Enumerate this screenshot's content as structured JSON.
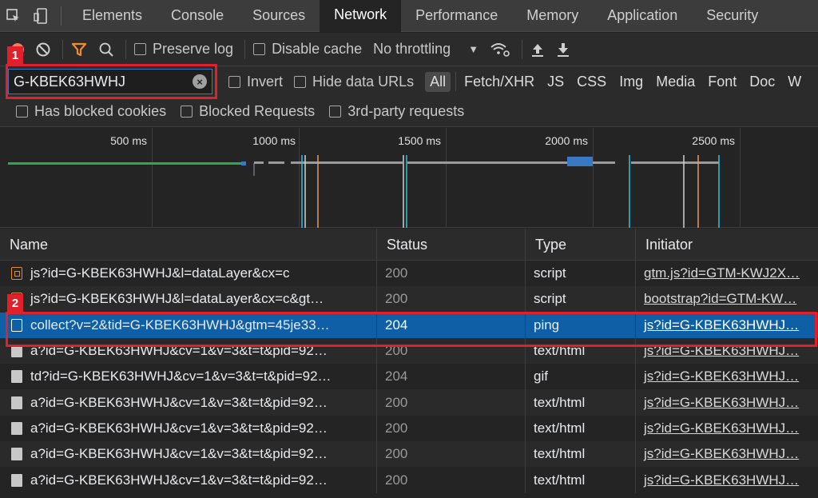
{
  "tabs": [
    "Elements",
    "Console",
    "Sources",
    "Network",
    "Performance",
    "Memory",
    "Application",
    "Security"
  ],
  "active_tab": "Network",
  "toolbar": {
    "preserve_log": "Preserve log",
    "disable_cache": "Disable cache",
    "throttling": "No throttling"
  },
  "filter": {
    "value": "G-KBEK63HWHJ",
    "invert": "Invert",
    "hide_data_urls": "Hide data URLs",
    "types": [
      "All",
      "Fetch/XHR",
      "JS",
      "CSS",
      "Img",
      "Media",
      "Font",
      "Doc",
      "W"
    ]
  },
  "blocked": {
    "has_blocked_cookies": "Has blocked cookies",
    "blocked_requests": "Blocked Requests",
    "third_party": "3rd-party requests"
  },
  "overview": {
    "labels": [
      "500 ms",
      "1000 ms",
      "1500 ms",
      "2000 ms",
      "2500 ms"
    ]
  },
  "table": {
    "headers": {
      "name": "Name",
      "status": "Status",
      "type": "Type",
      "initiator": "Initiator"
    },
    "rows": [
      {
        "name": "js?id=G-KBEK63HWHJ&l=dataLayer&cx=c",
        "status": "200",
        "type": "script",
        "initiator": "gtm.js?id=GTM-KWJ2X…",
        "icon": "script"
      },
      {
        "name": "js?id=G-KBEK63HWHJ&l=dataLayer&cx=c&gt…",
        "status": "200",
        "type": "script",
        "initiator": "bootstrap?id=GTM-KW…",
        "icon": "script"
      },
      {
        "name": "collect?v=2&tid=G-KBEK63HWHJ&gtm=45je33…",
        "status": "204",
        "type": "ping",
        "initiator": "js?id=G-KBEK63HWHJ…",
        "icon": "ping"
      },
      {
        "name": "a?id=G-KBEK63HWHJ&cv=1&v=3&t=t&pid=92…",
        "status": "200",
        "type": "text/html",
        "initiator": "js?id=G-KBEK63HWHJ…",
        "icon": "doc"
      },
      {
        "name": "td?id=G-KBEK63HWHJ&cv=1&v=3&t=t&pid=92…",
        "status": "204",
        "type": "gif",
        "initiator": "js?id=G-KBEK63HWHJ…",
        "icon": "doc"
      },
      {
        "name": "a?id=G-KBEK63HWHJ&cv=1&v=3&t=t&pid=92…",
        "status": "200",
        "type": "text/html",
        "initiator": "js?id=G-KBEK63HWHJ…",
        "icon": "doc"
      },
      {
        "name": "a?id=G-KBEK63HWHJ&cv=1&v=3&t=t&pid=92…",
        "status": "200",
        "type": "text/html",
        "initiator": "js?id=G-KBEK63HWHJ…",
        "icon": "doc"
      },
      {
        "name": "a?id=G-KBEK63HWHJ&cv=1&v=3&t=t&pid=92…",
        "status": "200",
        "type": "text/html",
        "initiator": "js?id=G-KBEK63HWHJ…",
        "icon": "doc"
      },
      {
        "name": "a?id=G-KBEK63HWHJ&cv=1&v=3&t=t&pid=92…",
        "status": "200",
        "type": "text/html",
        "initiator": "js?id=G-KBEK63HWHJ…",
        "icon": "doc"
      }
    ]
  },
  "annotations": [
    "1",
    "2"
  ],
  "colors": {
    "accent": "#0e5fa6",
    "annotation": "#e0202a",
    "record": "#f47b5b",
    "filter_icon": "#f28b30"
  }
}
